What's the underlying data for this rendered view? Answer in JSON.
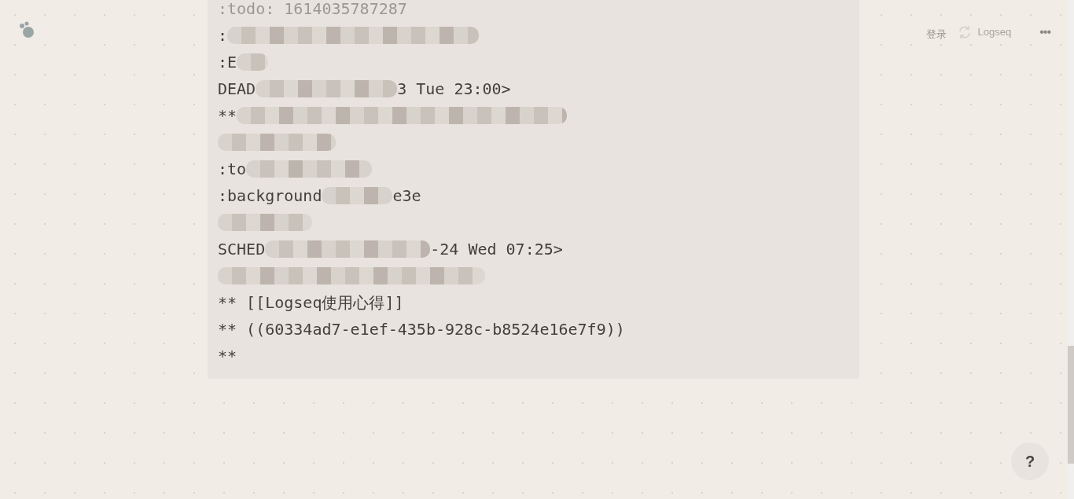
{
  "header": {
    "login": "登录",
    "sync_title": "Logseq",
    "menu": "•••"
  },
  "code_lines": [
    {
      "faded": true,
      "segments": [
        {
          "kind": "text",
          "text": ":todo: 1614035787287"
        }
      ]
    },
    {
      "faded": false,
      "segments": [
        {
          "kind": "text",
          "text": ":"
        },
        {
          "kind": "blur"
        }
      ]
    },
    {
      "faded": false,
      "segments": [
        {
          "kind": "text",
          "text": ":E"
        },
        {
          "kind": "blur"
        }
      ]
    },
    {
      "faded": false,
      "segments": [
        {
          "kind": "text",
          "text": "DEAD"
        },
        {
          "kind": "blur"
        },
        {
          "kind": "text",
          "text": "3 Tue 23:00>"
        }
      ]
    },
    {
      "faded": false,
      "segments": [
        {
          "kind": "text",
          "text": "**"
        },
        {
          "kind": "blur"
        }
      ]
    },
    {
      "faded": false,
      "segments": [
        {
          "kind": "blur"
        }
      ]
    },
    {
      "faded": false,
      "segments": [
        {
          "kind": "text",
          "text": ":to"
        },
        {
          "kind": "blur"
        }
      ]
    },
    {
      "faded": false,
      "segments": [
        {
          "kind": "text",
          "text": ":background"
        },
        {
          "kind": "blur"
        },
        {
          "kind": "text",
          "text": "e3e"
        }
      ]
    },
    {
      "faded": false,
      "segments": [
        {
          "kind": "blur"
        }
      ]
    },
    {
      "faded": false,
      "segments": [
        {
          "kind": "text",
          "text": "SCHED"
        },
        {
          "kind": "blur"
        },
        {
          "kind": "text",
          "text": "-24 Wed 07:25>"
        }
      ]
    },
    {
      "faded": false,
      "segments": [
        {
          "kind": "blur"
        }
      ]
    },
    {
      "faded": false,
      "segments": [
        {
          "kind": "text",
          "text": "** [[Logseq使用心得]]"
        }
      ]
    },
    {
      "faded": false,
      "segments": [
        {
          "kind": "text",
          "text": "** ((60334ad7-e1ef-435b-928c-b8524e16e7f9))"
        }
      ]
    },
    {
      "faded": false,
      "segments": [
        {
          "kind": "text",
          "text": "**"
        }
      ]
    }
  ],
  "help_button": "?"
}
